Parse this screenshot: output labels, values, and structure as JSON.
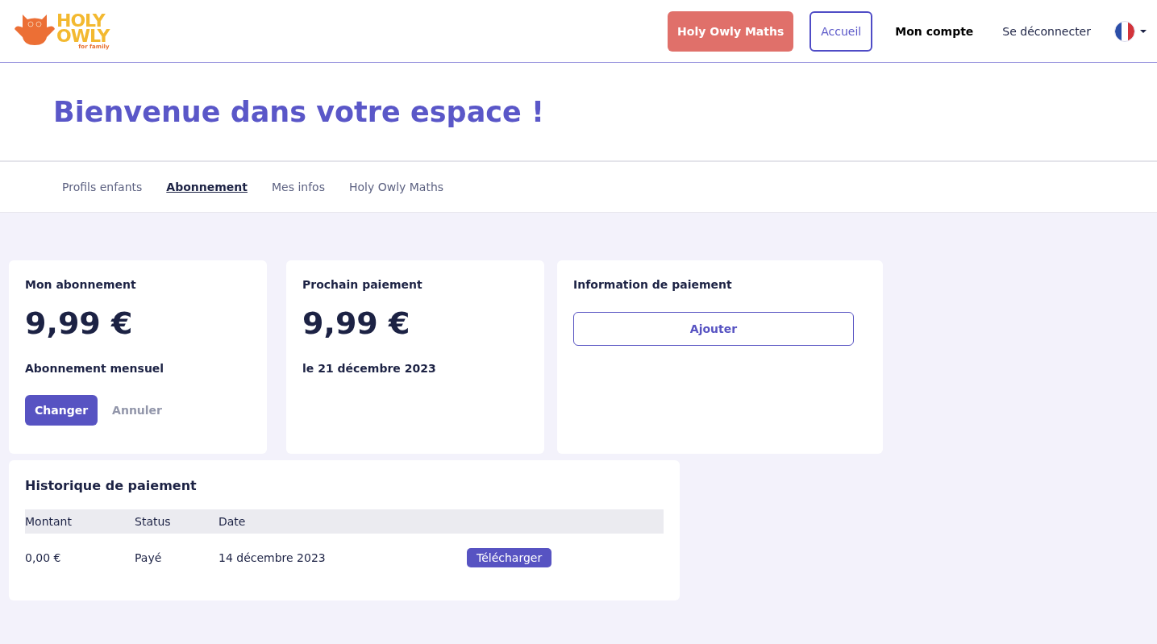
{
  "logo": {
    "line_1": "HOLY",
    "line_2": "OWLY",
    "tagline": "for family"
  },
  "nav": [
    {
      "label": "Holy Owly Maths",
      "kind": "primary",
      "selected": false
    },
    {
      "label": "Accueil",
      "kind": "outline",
      "selected": false
    },
    {
      "label": "Mon compte",
      "kind": "link",
      "selected": true
    },
    {
      "label": "Se déconnecter",
      "kind": "link",
      "selected": false
    }
  ],
  "hero": {
    "title": "Bienvenue dans votre espace !"
  },
  "tabs": [
    {
      "label": "Profils enfants",
      "selected": false
    },
    {
      "label": "Abonnement",
      "selected": true
    },
    {
      "label": "Mes infos",
      "selected": false
    },
    {
      "label": "Holy Owly Maths",
      "selected": false
    }
  ],
  "subscription": {
    "title": "Mon abonnement",
    "price": "9,99 €",
    "plan": "Abonnement mensuel",
    "change": "Changer",
    "cancel": "Annuler"
  },
  "next_payment": {
    "title": "Prochain paiement",
    "price": "9,99 €",
    "date": "le 21 décembre 2023"
  },
  "payment_info": {
    "title": "Information de paiement",
    "add": "Ajouter"
  },
  "history": {
    "title": "Historique de paiement",
    "columns": [
      "Montant",
      "Status",
      "Date"
    ],
    "rows": [
      {
        "amount": "0,00 €",
        "status": "Payé",
        "date": "14 décembre 2023",
        "action": "Télécharger"
      }
    ]
  }
}
